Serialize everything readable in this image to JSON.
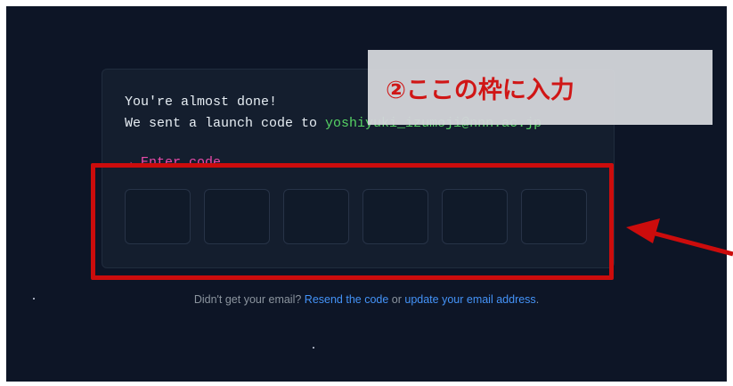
{
  "card": {
    "almost_done": "You're almost done!",
    "sent_prefix": "We sent a launch code to ",
    "email": "yoshiyuki_izumoji@nnn.ac.jp",
    "enter_code": "→ Enter code",
    "code_boxes": [
      "",
      "",
      "",
      "",
      "",
      ""
    ]
  },
  "footer": {
    "prefix": "Didn't get your email? ",
    "resend_link": "Resend the code",
    "middle": " or ",
    "update_link": "update your email address",
    "suffix": "."
  },
  "annotation": {
    "note_text": "②ここの枠に入力",
    "note_text_color": "#d01616",
    "highlight_color": "#cc0c0c"
  },
  "colors": {
    "background": "#0d1526",
    "email_green": "#56d364",
    "enter_code_pink": "#ea4aaa",
    "link_blue": "#4493f8"
  }
}
